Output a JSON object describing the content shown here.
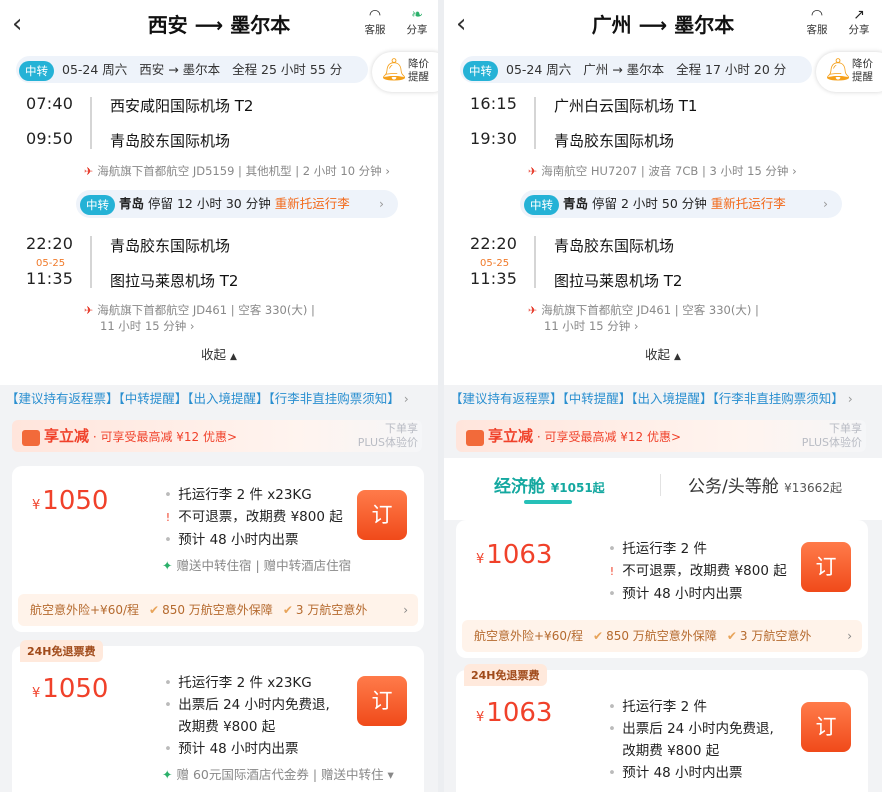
{
  "screens": [
    {
      "title": "西安 ⟶ 墨尔本",
      "service": "客服",
      "share": "分享",
      "summary": {
        "tag": "中转",
        "date": "05-24 周六",
        "route": "西安 → 墨尔本",
        "duration": "全程 25 小时 55 分"
      },
      "alarm": "降价提醒",
      "seg1": {
        "dep_time": "07:40",
        "dep_apt": "西安咸阳国际机场 T2",
        "arr_time": "09:50",
        "arr_apt": "青岛胶东国际机场",
        "flight": "海航旗下首都航空 JD5159",
        "plane": "其他机型",
        "dur": "2 小时 10 分钟"
      },
      "layover": {
        "tag": "中转",
        "city": "青岛",
        "stay": "停留 12 小时 30 分钟",
        "bag": "重新托运行李"
      },
      "seg2": {
        "dep_time": "22:20",
        "dep_apt": "青岛胶东国际机场",
        "arr_date": "05-25",
        "arr_time": "11:35",
        "arr_apt": "图拉马莱恩机场 T2",
        "flight": "海航旗下首都航空 JD461",
        "plane": "空客 330(大)",
        "dur": "11 小时 15 分钟"
      },
      "collapse": "收起",
      "notice": "【建议持有返程票】【中转提醒】【出入境提醒】【行李非直挂购票须知】",
      "promo": {
        "brand": "享立减",
        "text": "· 可享受最高减 ¥12 优惠>",
        "plus1": "下单享",
        "plus2": "PLUS体验价"
      },
      "cards": [
        {
          "currency": "¥",
          "price": "1050",
          "lines": [
            "托运行李 2 件 x23KG",
            "不可退票，改期费 ¥800 起",
            "预计 48 小时内出票"
          ],
          "gift": "赠送中转住宿 | 赠中转酒店住宿",
          "book": "订",
          "ins": {
            "a": "航空意外险+¥60/程",
            "b": "850 万航空意外保障",
            "c": "3 万航空意外"
          }
        },
        {
          "badge": "24H免退票费",
          "currency": "¥",
          "price": "1050",
          "lines": [
            "托运行李 2 件 x23KG",
            "出票后 24 小时内免费退,",
            "改期费 ¥800 起",
            "预计 48 小时内出票"
          ],
          "gift": "赠 60元国际酒店代金券 | 赠送中转住",
          "book": "订"
        }
      ]
    },
    {
      "title": "广州 ⟶ 墨尔本",
      "service": "客服",
      "share": "分享",
      "summary": {
        "tag": "中转",
        "date": "05-24 周六",
        "route": "广州 → 墨尔本",
        "duration": "全程 17 小时 20 分"
      },
      "alarm": "降价提醒",
      "seg1": {
        "dep_time": "16:15",
        "dep_apt": "广州白云国际机场 T1",
        "arr_time": "19:30",
        "arr_apt": "青岛胶东国际机场",
        "flight": "海南航空 HU7207",
        "plane": "波音 7CB",
        "dur": "3 小时 15 分钟"
      },
      "layover": {
        "tag": "中转",
        "city": "青岛",
        "stay": "停留 2 小时 50 分钟",
        "bag": "重新托运行李"
      },
      "seg2": {
        "dep_time": "22:20",
        "dep_apt": "青岛胶东国际机场",
        "arr_date": "05-25",
        "arr_time": "11:35",
        "arr_apt": "图拉马莱恩机场 T2",
        "flight": "海航旗下首都航空 JD461",
        "plane": "空客 330(大)",
        "dur": "11 小时 15 分钟"
      },
      "collapse": "收起",
      "notice": "【建议持有返程票】【中转提醒】【出入境提醒】【行李非直挂购票须知】",
      "promo": {
        "brand": "享立减",
        "text": "· 可享受最高减 ¥12 优惠>",
        "plus1": "下单享",
        "plus2": "PLUS体验价"
      },
      "tabs": {
        "eco": "经济舱",
        "eco_price": "¥1051起",
        "biz": "公务/头等舱",
        "biz_price": "¥13662起"
      },
      "cards": [
        {
          "currency": "¥",
          "price": "1063",
          "lines": [
            "托运行李 2 件",
            "不可退票，改期费 ¥800 起",
            "预计 48 小时内出票"
          ],
          "book": "订",
          "ins": {
            "a": "航空意外险+¥60/程",
            "b": "850 万航空意外保障",
            "c": "3 万航空意外"
          }
        },
        {
          "badge": "24H免退票费",
          "currency": "¥",
          "price": "1063",
          "lines": [
            "托运行李 2 件",
            "出票后 24 小时内免费退,",
            "改期费 ¥800 起",
            "预计 48 小时内出票"
          ],
          "book": "订"
        }
      ]
    }
  ]
}
